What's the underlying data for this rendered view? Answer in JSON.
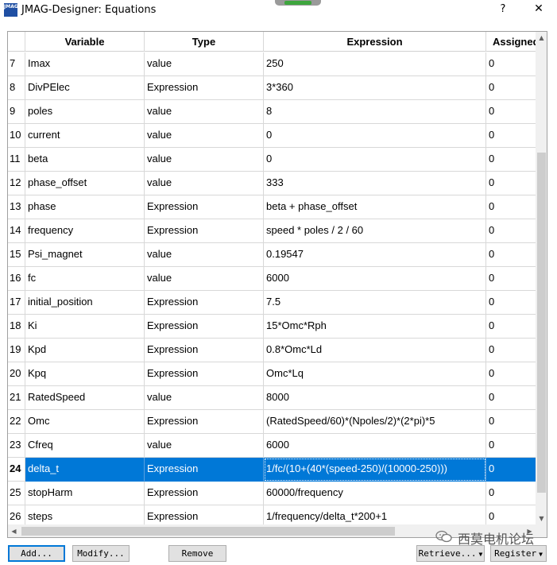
{
  "window": {
    "title": "JMAG-Designer: Equations",
    "icon_text": "JMAG",
    "help_label": "?",
    "close_label": "✕"
  },
  "table": {
    "columns": [
      "Variable",
      "Type",
      "Expression",
      "Assigned"
    ],
    "selected_row": "24",
    "rows": [
      {
        "num": "7",
        "variable": "Imax",
        "type": "value",
        "expression": "250",
        "assigned": "0"
      },
      {
        "num": "8",
        "variable": "DivPElec",
        "type": "Expression",
        "expression": "3*360",
        "assigned": "0"
      },
      {
        "num": "9",
        "variable": "poles",
        "type": "value",
        "expression": "8",
        "assigned": "0"
      },
      {
        "num": "10",
        "variable": "current",
        "type": "value",
        "expression": "0",
        "assigned": "0"
      },
      {
        "num": "11",
        "variable": "beta",
        "type": "value",
        "expression": "0",
        "assigned": "0"
      },
      {
        "num": "12",
        "variable": "phase_offset",
        "type": "value",
        "expression": "333",
        "assigned": "0"
      },
      {
        "num": "13",
        "variable": "phase",
        "type": "Expression",
        "expression": "beta + phase_offset",
        "assigned": "0"
      },
      {
        "num": "14",
        "variable": "frequency",
        "type": "Expression",
        "expression": "speed * poles / 2 / 60",
        "assigned": "0"
      },
      {
        "num": "15",
        "variable": "Psi_magnet",
        "type": "value",
        "expression": "0.19547",
        "assigned": "0"
      },
      {
        "num": "16",
        "variable": "fc",
        "type": "value",
        "expression": "6000",
        "assigned": "0"
      },
      {
        "num": "17",
        "variable": "initial_position",
        "type": "Expression",
        "expression": "7.5",
        "assigned": "0"
      },
      {
        "num": "18",
        "variable": "Ki",
        "type": "Expression",
        "expression": "15*Omc*Rph",
        "assigned": "0"
      },
      {
        "num": "19",
        "variable": "Kpd",
        "type": "Expression",
        "expression": "0.8*Omc*Ld",
        "assigned": "0"
      },
      {
        "num": "20",
        "variable": "Kpq",
        "type": "Expression",
        "expression": "Omc*Lq",
        "assigned": "0"
      },
      {
        "num": "21",
        "variable": "RatedSpeed",
        "type": "value",
        "expression": "8000",
        "assigned": "0"
      },
      {
        "num": "22",
        "variable": "Omc",
        "type": "Expression",
        "expression": "(RatedSpeed/60)*(Npoles/2)*(2*pi)*5",
        "assigned": "0"
      },
      {
        "num": "23",
        "variable": "Cfreq",
        "type": "value",
        "expression": "6000",
        "assigned": "0"
      },
      {
        "num": "24",
        "variable": "delta_t",
        "type": "Expression",
        "expression": "1/fc/(10+(40*(speed-250)/(10000-250)))",
        "assigned": "0"
      },
      {
        "num": "25",
        "variable": "stopHarm",
        "type": "Expression",
        "expression": "60000/frequency",
        "assigned": "0"
      },
      {
        "num": "26",
        "variable": "steps",
        "type": "Expression",
        "expression": "1/frequency/delta_t*200+1",
        "assigned": "0"
      }
    ]
  },
  "buttons": {
    "add": "Add...",
    "modify": "Modify...",
    "remove": "Remove",
    "retrieve": "Retrieve...",
    "register": "Register"
  },
  "watermark": {
    "text": "西莫电机论坛"
  },
  "colors": {
    "selection": "#0078d7",
    "focus_border": "#0078d7"
  }
}
